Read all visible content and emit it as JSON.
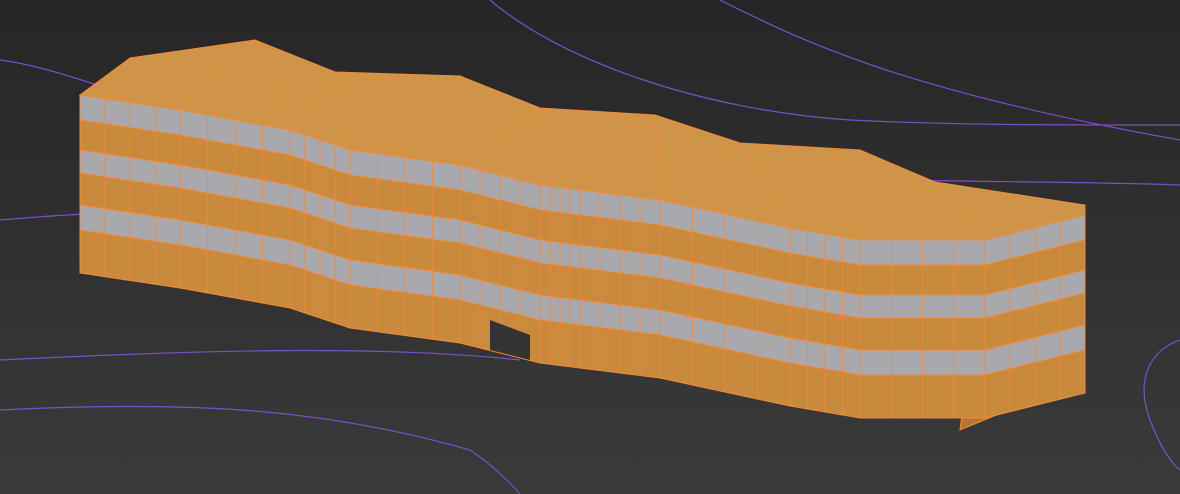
{
  "viewport": {
    "colors": {
      "background_top": "#262626",
      "background_bottom": "#3a3a3a",
      "spline": "#7a4fc8",
      "wood": "#c98a3e",
      "wood_dark": "#b5772f",
      "roof": "#d09448",
      "edge": "#f08a3a",
      "glass": "#a9a9ad"
    },
    "object": "building-wireframe-shaded"
  }
}
